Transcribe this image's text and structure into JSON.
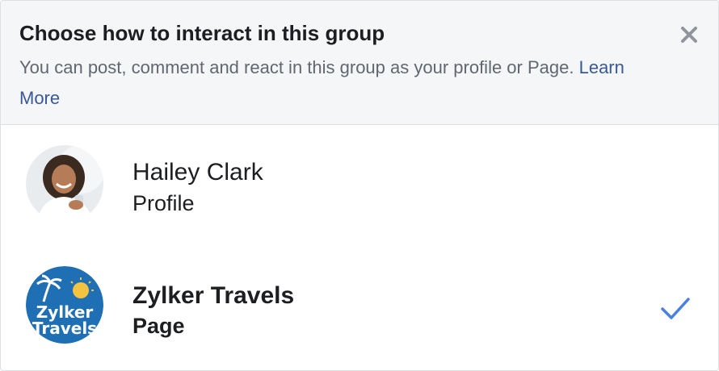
{
  "dialog": {
    "title": "Choose how to interact in this group",
    "description": "You can post, comment and react in this group as your profile or Page.",
    "learn_more": "Learn More",
    "close_icon": "close-icon"
  },
  "options": [
    {
      "name": "Hailey Clark",
      "type": "Profile",
      "selected": false,
      "avatar_icon": "person-avatar"
    },
    {
      "name": "Zylker Travels",
      "type": "Page",
      "selected": true,
      "avatar_icon": "zylker-travels-logo",
      "logo_text_line1": "Zylker",
      "logo_text_line2": "Travels"
    }
  ],
  "colors": {
    "header_bg": "#f5f6f7",
    "link": "#385898",
    "check": "#4a80e0",
    "logo_blue": "#1f6fb5"
  }
}
